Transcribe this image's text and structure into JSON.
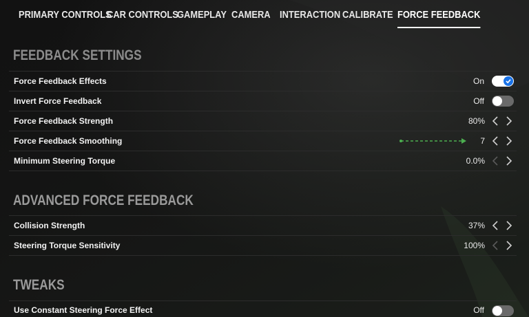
{
  "nav": {
    "tabs": [
      {
        "label": "PRIMARY CONTROLS"
      },
      {
        "label": "CAR CONTROLS"
      },
      {
        "label": "GAMEPLAY"
      },
      {
        "label": "CAMERA"
      },
      {
        "label": "INTERACTION"
      },
      {
        "label": "CALIBRATE"
      },
      {
        "label": "FORCE FEEDBACK",
        "active": true
      }
    ]
  },
  "sections": {
    "feedback": {
      "title": "FEEDBACK SETTINGS",
      "rows": [
        {
          "label": "Force Feedback Effects",
          "value": "On",
          "control": "toggle",
          "state": "on"
        },
        {
          "label": "Invert Force Feedback",
          "value": "Off",
          "control": "toggle",
          "state": "off"
        },
        {
          "label": "Force Feedback Strength",
          "value": "80%",
          "control": "arrows"
        },
        {
          "label": "Force Feedback Smoothing",
          "value": "7",
          "control": "arrows"
        },
        {
          "label": "Minimum Steering Torque",
          "value": "0.0%",
          "control": "arrows"
        }
      ]
    },
    "advanced": {
      "title": "ADVANCED FORCE FEEDBACK",
      "rows": [
        {
          "label": "Collision Strength",
          "value": "37%",
          "control": "arrows"
        },
        {
          "label": "Steering Torque Sensitivity",
          "value": "100%",
          "control": "arrows"
        }
      ]
    },
    "tweaks": {
      "title": "TWEAKS",
      "rows": [
        {
          "label": "Use Constant Steering Force Effect",
          "value": "Off",
          "control": "toggle",
          "state": "off"
        }
      ]
    }
  },
  "colors": {
    "accent": "#1a73e8",
    "annotation": "#4caf50",
    "toggle_off": "#6a6a6a"
  }
}
